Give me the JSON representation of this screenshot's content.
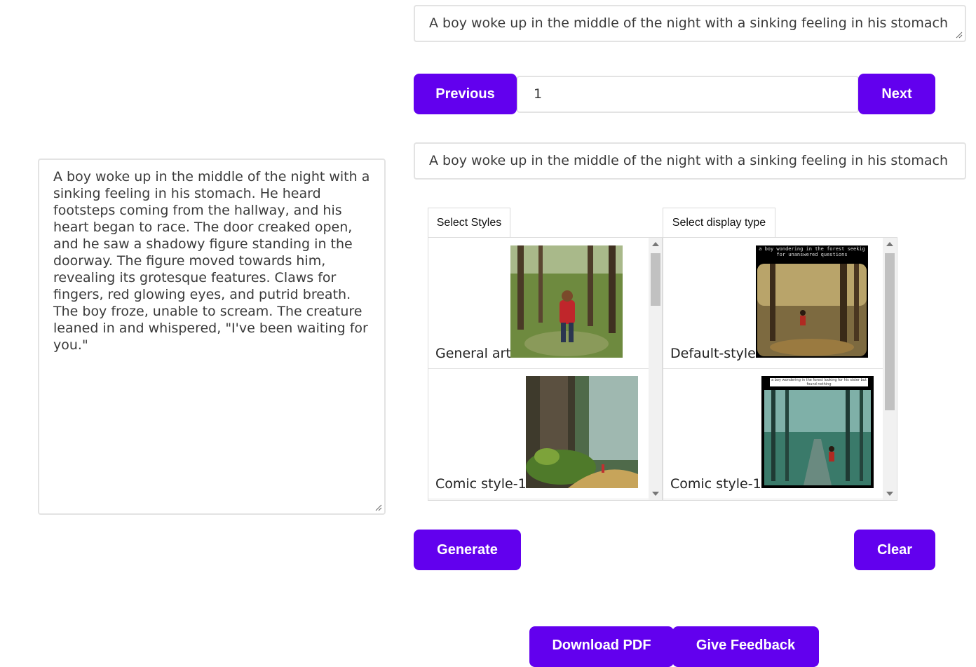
{
  "prompt_top": {
    "value": "A boy woke up in the middle of the night with a sinking feeling in his stomach"
  },
  "pager": {
    "previous_label": "Previous",
    "page_value": "1",
    "next_label": "Next"
  },
  "prompt_second": {
    "value": "A boy woke up in the middle of the night with a sinking feeling in his stomach"
  },
  "story": {
    "text": "A boy woke up in the middle of the night with a sinking feeling in his stomach. He heard footsteps coming from the hallway, and his heart began to race. The door creaked open, and he saw a shadowy figure standing in the doorway. The figure moved towards him, revealing its grotesque features. Claws for fingers, red glowing eyes, and putrid breath. The boy froze, unable to scream. The creature leaned in and whispered, \"I've been waiting for you.\""
  },
  "styles_panel": {
    "tab_label": "Select Styles",
    "items": [
      {
        "label": "General art",
        "thumb": "boy-red-jacket-forest"
      },
      {
        "label": "Comic style-1",
        "thumb": "mossy-forest-path"
      }
    ]
  },
  "display_panel": {
    "tab_label": "Select display type",
    "items": [
      {
        "label": "Default-style",
        "thumb": "boy-forest-caption",
        "caption": "a boy wondering in the forest seekig for unanswered questions"
      },
      {
        "label": "Comic style-1",
        "thumb": "boy-teal-forest-comic",
        "caption": "a boy wondering in the forest looking for his sister but found nothing"
      }
    ]
  },
  "actions": {
    "generate_label": "Generate",
    "clear_label": "Clear"
  },
  "footer": {
    "download_label": "Download PDF",
    "feedback_label": "Give Feedback"
  },
  "colors": {
    "accent": "#6200ee",
    "border": "#e3e3e3"
  }
}
